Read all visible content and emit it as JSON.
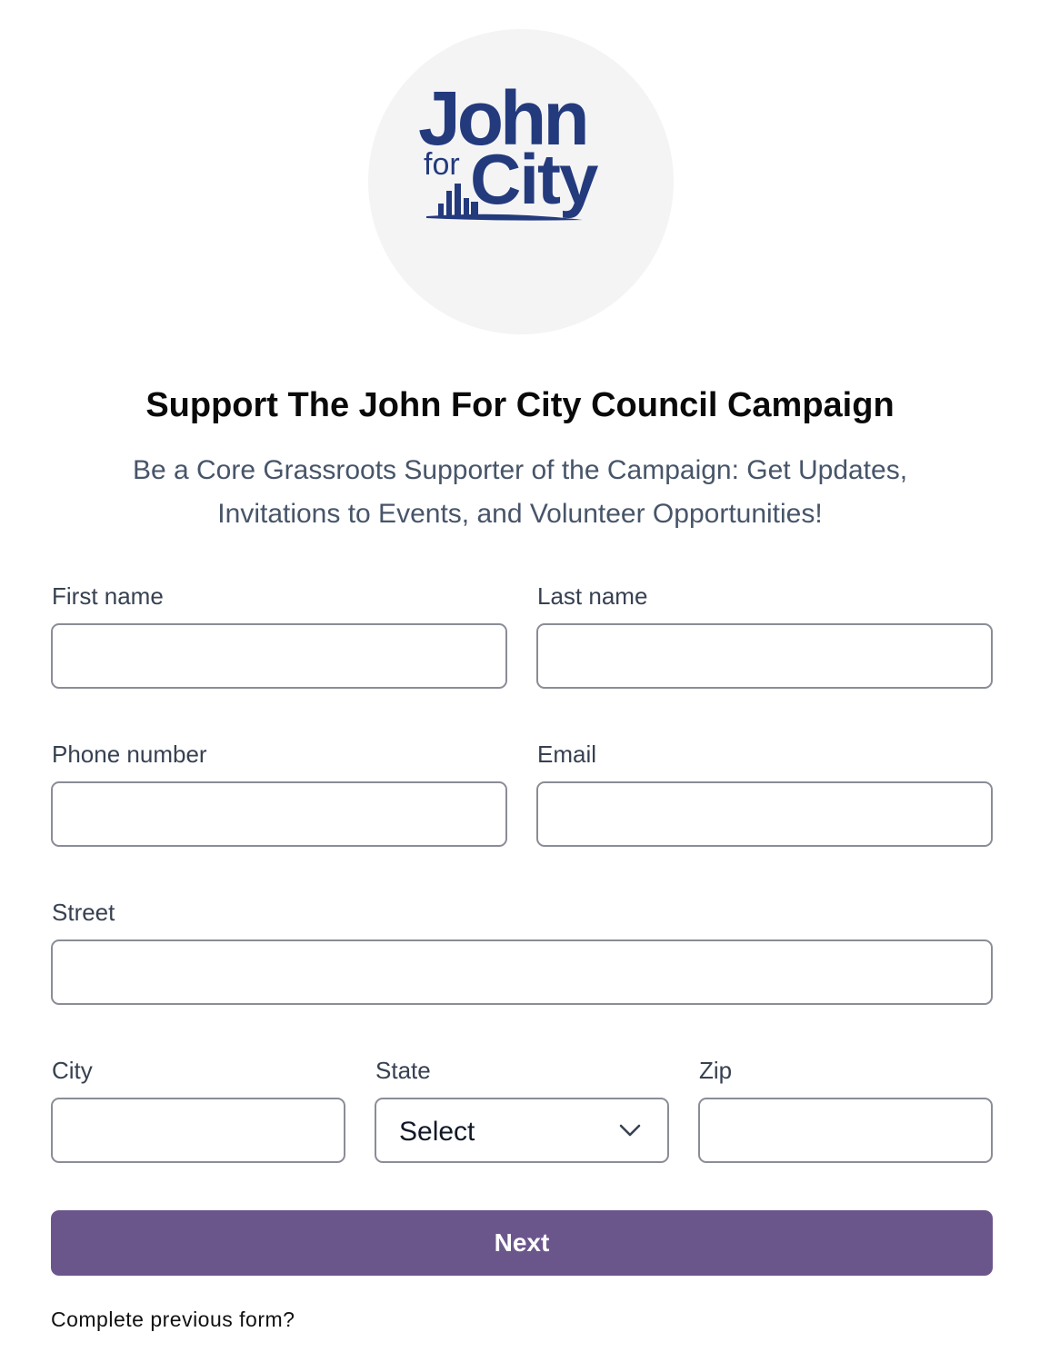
{
  "logo": {
    "line1": "John",
    "line2_small": "for",
    "line2_large": "City",
    "brand_color": "#233a7d"
  },
  "header": {
    "title": "Support The John For City Council Campaign",
    "subtitle": "Be a Core Grassroots Supporter of the Campaign: Get Updates, Invitations to Events, and Volunteer Opportunities!"
  },
  "form": {
    "first_name": {
      "label": "First name",
      "value": ""
    },
    "last_name": {
      "label": "Last name",
      "value": ""
    },
    "phone": {
      "label": "Phone number",
      "value": ""
    },
    "email": {
      "label": "Email",
      "value": ""
    },
    "street": {
      "label": "Street",
      "value": ""
    },
    "city": {
      "label": "City",
      "value": ""
    },
    "state": {
      "label": "State",
      "selected": "Select",
      "icon": "chevron-down-icon"
    },
    "zip": {
      "label": "Zip",
      "value": ""
    }
  },
  "actions": {
    "next_label": "Next",
    "previous_link": "Complete previous form?"
  },
  "colors": {
    "accent": "#6b568c",
    "border": "#8a8d96",
    "label_text": "#374151",
    "subtitle_text": "#475569"
  }
}
